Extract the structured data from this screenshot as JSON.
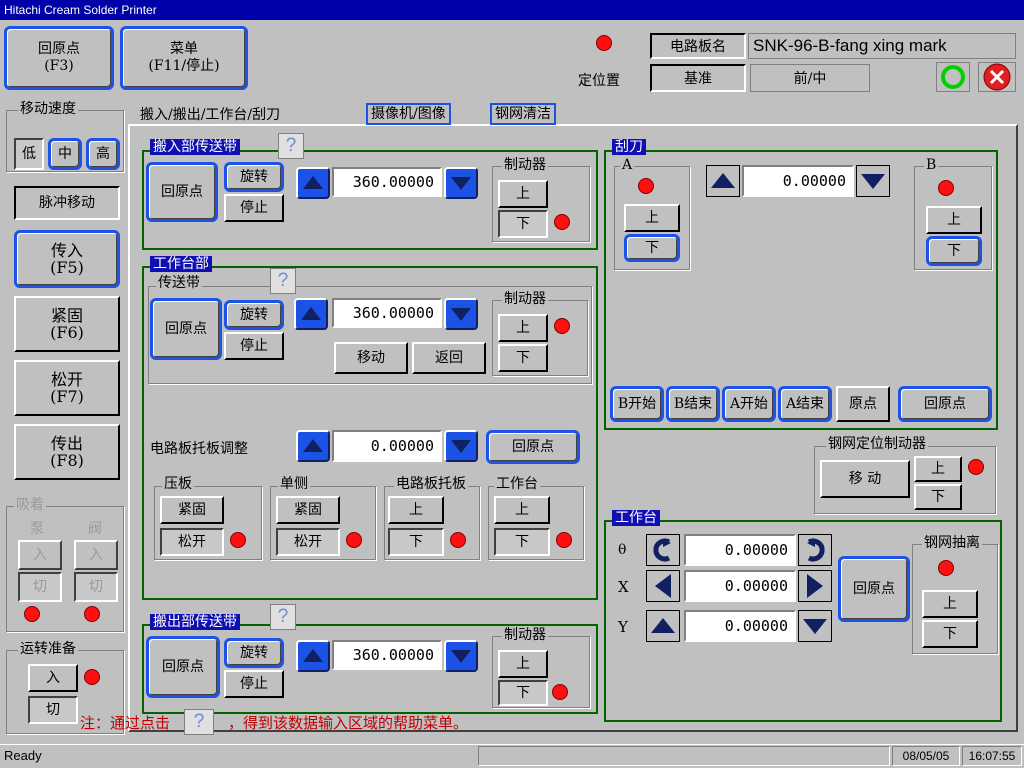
{
  "window": {
    "title": "Hitachi Cream Solder Printer"
  },
  "top": {
    "home_btn": "回原点\n(F3)",
    "menu_btn": "菜单\n(F11/停止)",
    "position_label": "定位置",
    "board_name_label": "电路板名",
    "board_name_value": "SNK-96-B-fang xing mark",
    "reference_label": "基准",
    "position_value": "前/中"
  },
  "left": {
    "speed_group": "移动速度",
    "speed_low": "低",
    "speed_mid": "中",
    "speed_high": "高",
    "pulse_move": "脉冲移动",
    "load_btn": "传入\n(F5)",
    "clamp_btn": "紧固\n(F6)",
    "release_btn": "松开\n(F7)",
    "unload_btn": "传出\n(F8)",
    "suction_group": "吸着",
    "pump_label": "泵",
    "valve_label": "阀",
    "pump_on": "入",
    "valve_on": "入",
    "pump_off": "切",
    "valve_off": "切",
    "ready_group": "运转准备",
    "ready_on": "入",
    "ready_off": "切"
  },
  "tabs": [
    "搬入/搬出/工作台/刮刀",
    "摄像机/图像",
    "钢网清洁"
  ],
  "infeed": {
    "title": "搬入部传送带",
    "help": "?",
    "home": "回原点",
    "rotate": "旋转",
    "stop": "停止",
    "value": "360.00000",
    "brake_group": "制动器",
    "up": "上",
    "down": "下"
  },
  "worktable_section": {
    "title": "工作台部",
    "conveyor_group": "传送带",
    "help": "?",
    "home": "回原点",
    "rotate": "旋转",
    "stop": "停止",
    "value": "360.00000",
    "move": "移动",
    "return": "返回",
    "brake_group": "制动器",
    "up": "上",
    "down": "下",
    "board_support_label": "电路板托板调整",
    "board_support_value": "0.00000",
    "board_support_home": "回原点",
    "press_group": "压板",
    "press_clamp": "紧固",
    "press_release": "松开",
    "single_group": "单侧",
    "single_clamp": "紧固",
    "single_release": "松开",
    "support_group": "电路板托板",
    "support_up": "上",
    "support_down": "下",
    "table_group": "工作台",
    "table_up": "上",
    "table_down": "下"
  },
  "outfeed": {
    "title": "搬出部传送带",
    "help": "?",
    "home": "回原点",
    "rotate": "旋转",
    "stop": "停止",
    "value": "360.00000",
    "brake_group": "制动器",
    "up": "上",
    "down": "下"
  },
  "note": {
    "prefix": "注：通过点击",
    "icon": "?",
    "suffix": "，得到该数据输入区域的帮助菜单。"
  },
  "squeegee": {
    "title": "刮刀",
    "a_label": "A",
    "b_label": "B",
    "a_up": "上",
    "a_down": "下",
    "b_up": "上",
    "b_down": "下",
    "value": "0.00000",
    "b_start": "B开始",
    "b_end": "B结束",
    "a_start": "A开始",
    "a_end": "A结束",
    "origin": "原点",
    "home": "回原点"
  },
  "stencil_brake": {
    "title": "钢网定位制动器",
    "move": "移 动",
    "up": "上",
    "down": "下"
  },
  "table": {
    "title": "工作台",
    "theta_label": "θ",
    "x_label": "X",
    "y_label": "Y",
    "theta_value": "0.00000",
    "x_value": "0.00000",
    "y_value": "0.00000",
    "home": "回原点",
    "separation_group": "钢网抽离",
    "up": "上",
    "down": "下"
  },
  "status": {
    "text": "Ready",
    "date": "08/05/05",
    "time": "16:07:55"
  },
  "colors": {
    "title_bar": "#0000a8",
    "accent_blue": "#1c52e6",
    "frame_green": "#006400",
    "led_red": "#ff1010",
    "note_red": "#c00000"
  }
}
